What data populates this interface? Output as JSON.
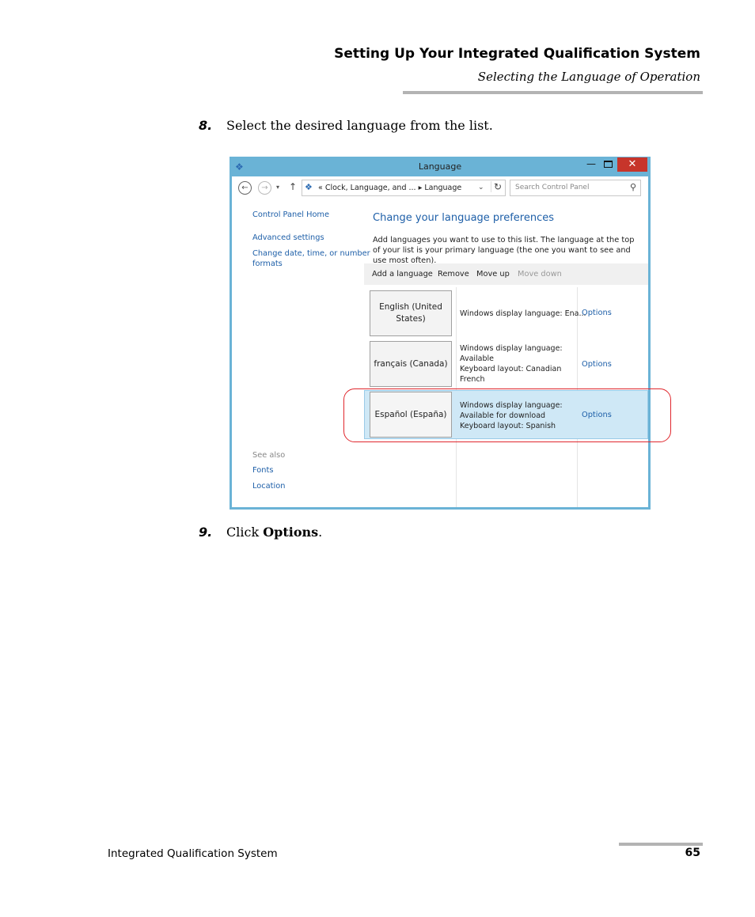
{
  "header": {
    "title": "Setting Up Your Integrated Qualification System",
    "subtitle": "Selecting the Language of Operation"
  },
  "steps": [
    {
      "number": "8.",
      "text": "Select the desired language from the list."
    },
    {
      "number": "9.",
      "text_prefix": "Click ",
      "text_bold": "Options",
      "text_suffix": "."
    }
  ],
  "window": {
    "title": "Language",
    "controls": {
      "minimize": "—",
      "close": "✕"
    },
    "address": {
      "back": "←",
      "forward": "→",
      "up": "↑",
      "path": "«  Clock, Language, and ...  ▸  Language",
      "search_placeholder": "Search Control Panel"
    },
    "sidebar": {
      "home": "Control Panel Home",
      "advanced": "Advanced settings",
      "change_date_1": "Change date, time, or number",
      "change_date_2": "formats",
      "see_also": "See also",
      "fonts": "Fonts",
      "location": "Location"
    },
    "main": {
      "heading": "Change your language preferences",
      "description": "Add languages you want to use to this list. The language at the top of your list is your primary language (the one you want to see and use most often).",
      "toolbar": {
        "add": "Add a language",
        "remove": "Remove",
        "move_up": "Move up",
        "move_down": "Move down"
      },
      "languages": [
        {
          "name": "English (United States)",
          "info": "Windows display language: Ena...",
          "options": "Options"
        },
        {
          "name": "français (Canada)",
          "info": "Windows display language:\nAvailable\nKeyboard layout: Canadian\nFrench",
          "options": "Options"
        },
        {
          "name": "Español (España)",
          "info": "Windows display language:\nAvailable for download\nKeyboard layout: Spanish",
          "options": "Options"
        }
      ]
    }
  },
  "footer": {
    "text": "Integrated Qualification System",
    "page": "65"
  },
  "colors": {
    "window_frame": "#6ab3d6",
    "link": "#1e5fa8",
    "selected_row": "#cfe8f6",
    "highlight_box": "#e0272d",
    "close_button": "#c7352b"
  }
}
